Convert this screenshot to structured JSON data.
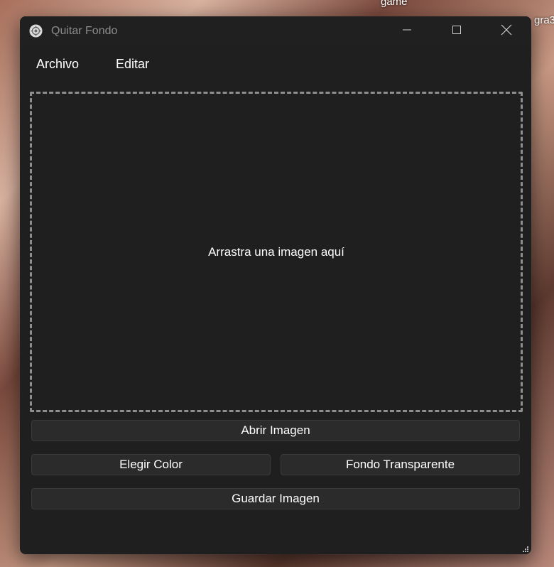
{
  "desktop": {
    "label_game": "game",
    "label_gra": "gra3"
  },
  "window": {
    "title": "Quitar Fondo",
    "app_icon": "gear-icon",
    "controls": {
      "minimize": "minimize-icon",
      "maximize": "maximize-icon",
      "close": "close-icon"
    }
  },
  "menu": {
    "items": [
      {
        "label": "Archivo"
      },
      {
        "label": "Editar"
      }
    ]
  },
  "drop_zone": {
    "text": "Arrastra una imagen aquí"
  },
  "buttons": {
    "open": "Abrir Imagen",
    "choose_color": "Elegir Color",
    "transparent": "Fondo Transparente",
    "save": "Guardar Imagen"
  },
  "colors": {
    "window_bg": "#1f1f1f",
    "button_bg": "#2b2b2b",
    "drop_border": "#8e8e8e",
    "text": "#ffffff",
    "title_text": "#8c8c8c"
  }
}
